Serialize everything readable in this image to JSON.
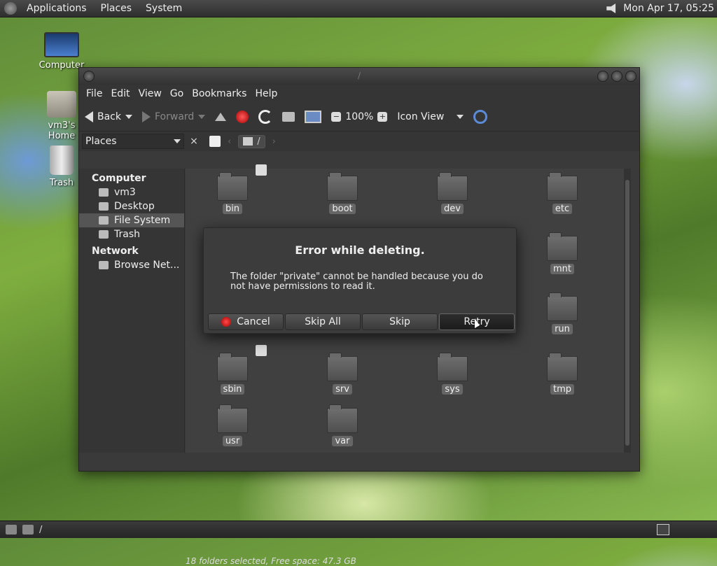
{
  "topbar": {
    "menus": [
      "Applications",
      "Places",
      "System"
    ],
    "datetime": "Mon Apr 17, 05:25"
  },
  "desktop": {
    "icons": [
      {
        "label": "Computer"
      },
      {
        "label": "vm3's Home"
      },
      {
        "label": "Trash"
      }
    ]
  },
  "window": {
    "title": "/",
    "menubar": [
      "File",
      "Edit",
      "View",
      "Go",
      "Bookmarks",
      "Help"
    ],
    "toolbar": {
      "back": "Back",
      "forward": "Forward",
      "zoom": "100%",
      "view_mode": "Icon View"
    },
    "locationbar": {
      "places_label": "Places",
      "close": "×",
      "path": "/"
    },
    "sidebar": {
      "computer_header": "Computer",
      "computer_items": [
        "vm3",
        "Desktop",
        "File System",
        "Trash"
      ],
      "active_item": "File System",
      "network_header": "Network",
      "network_items": [
        "Browse Net..."
      ]
    },
    "folders": [
      "bin",
      "boot",
      "dev",
      "etc",
      "mnt",
      "run",
      "sbin",
      "srv",
      "sys",
      "tmp",
      "usr",
      "var"
    ],
    "status": "18 folders selected, Free space: 47.3 GB"
  },
  "dialog": {
    "title": "Error while deleting.",
    "message": "The folder \"private\" cannot be handled because you do not have permissions to read it.",
    "buttons": {
      "cancel": "Cancel",
      "skip_all": "Skip All",
      "skip": "Skip",
      "retry": "Retry"
    }
  },
  "bottombar": {
    "path": "/"
  }
}
